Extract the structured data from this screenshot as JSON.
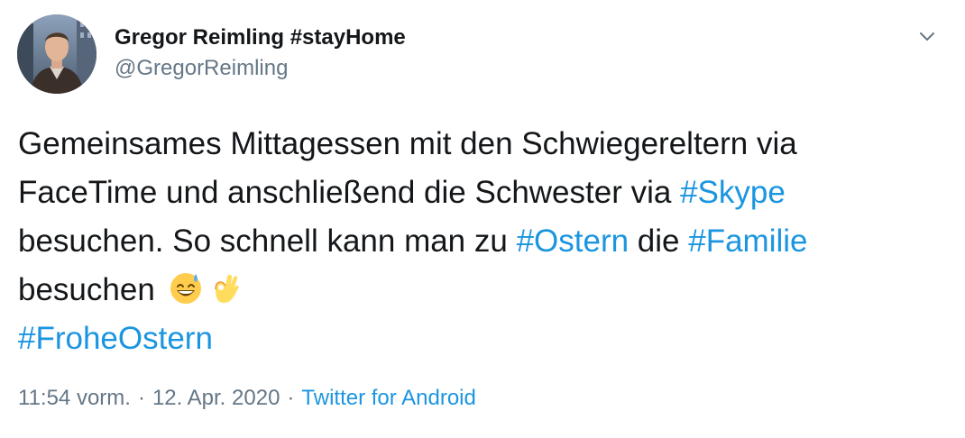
{
  "author": {
    "display_name": "Gregor Reimling #stayHome",
    "handle": "@GregorReimling"
  },
  "tweet": {
    "lines": [
      [
        {
          "t": "Gemeinsames Mittagessen mit den Schwiegereltern via"
        }
      ],
      [
        {
          "t": "FaceTime und anschließend die Schwester via "
        },
        {
          "t": "#Skype",
          "tag": true
        }
      ],
      [
        {
          "t": " besuchen. So schnell kann man zu "
        },
        {
          "t": "#Ostern",
          "tag": true
        },
        {
          "t": " die "
        },
        {
          "t": "#Familie",
          "tag": true
        }
      ],
      [
        {
          "t": " besuchen "
        },
        {
          "emoji": "grinning-sweat-emoji"
        },
        {
          "emoji": "ok-hand-emoji"
        }
      ],
      [
        {
          "t": "#FroheOstern",
          "tag": true
        }
      ]
    ]
  },
  "meta": {
    "time": "11:54 vorm.",
    "separator": "·",
    "date": "12. Apr. 2020",
    "source": "Twitter for Android"
  },
  "icons": {
    "caret": "chevron-down-icon"
  },
  "colors": {
    "text": "#14171a",
    "secondary": "#657786",
    "link": "#1b95e0"
  }
}
